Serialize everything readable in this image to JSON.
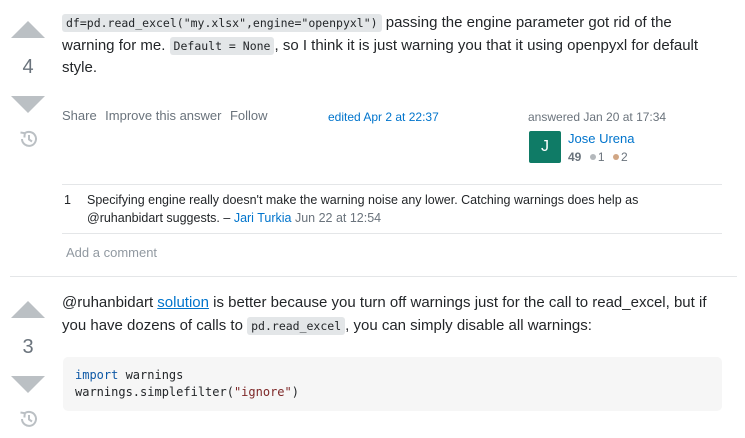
{
  "answer1": {
    "votes": "4",
    "code_inline": "df=pd.read_excel(\"my.xlsx\",engine=\"openpyxl\")",
    "text_a": " passing the engine parameter got rid of the warning for me. ",
    "code_inline_2": "Default = None",
    "text_b": ", so I think it is just warning you that it using openpyxl for default style.",
    "menu": {
      "share": "Share",
      "improve": "Improve this answer",
      "follow": "Follow"
    },
    "edited": "edited Apr 2 at 22:37",
    "answered": "answered Jan 20 at 17:34",
    "user": {
      "avatar_letter": "J",
      "name": "Jose Urena",
      "rep": "49",
      "silver": "1",
      "bronze": "2",
      "avatar_color": "#0f7b66"
    },
    "comment": {
      "score": "1",
      "text": "Specifying engine really doesn't make the warning noise any lower. Catching warnings does help as @ruhanbidart suggests. – ",
      "author": "Jari Turkia",
      "date": " Jun 22 at 12:54"
    },
    "add_comment": "Add a comment"
  },
  "answer2": {
    "votes": "3",
    "text_a": "@ruhanbidart ",
    "link": "solution",
    "text_b": " is better because you turn off warnings just for the call to read_excel, but if you have dozens of calls to ",
    "code_inline": "pd.read_excel",
    "text_c": ", you can simply disable all warnings:",
    "code_line1_kw": "import",
    "code_line1_rest": " warnings",
    "code_line2_a": "warnings.simplefilter(",
    "code_line2_str": "\"ignore\"",
    "code_line2_b": ")"
  },
  "colors": {
    "vote_arrow": "#bbc0c4",
    "link": "#0074cc",
    "silver_badge": "#b4b8bc",
    "bronze_badge": "#d1a684"
  },
  "icons": {
    "upvote": "triangle-up",
    "downvote": "triangle-down",
    "history": "clock-history"
  }
}
